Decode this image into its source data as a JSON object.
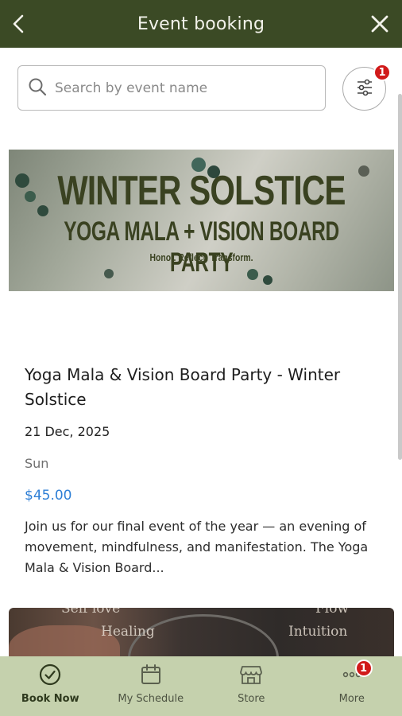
{
  "header": {
    "title": "Event booking"
  },
  "search": {
    "placeholder": "Search by event name",
    "value": ""
  },
  "filter": {
    "badge_count": "1"
  },
  "banner": {
    "line1": "WINTER SOLSTICE",
    "line2": "YOGA MALA + VISION BOARD PARTY",
    "line3": "Honor. Reflect. Transform."
  },
  "event": {
    "title": "Yoga Mala & Vision Board Party - Winter Solstice",
    "date": "21 Dec, 2025",
    "day": "Sun",
    "price": "$45.00",
    "description": "Join us for our final event of the year — an evening of movement, mindfulness, and manifestation. The Yoga Mala & Vision Board..."
  },
  "next_banner": {
    "words": [
      "Self love",
      "Flow",
      "Healing",
      "Intuition"
    ]
  },
  "nav": {
    "items": [
      {
        "label": "Book Now",
        "icon": "check-circle-icon"
      },
      {
        "label": "My Schedule",
        "icon": "calendar-icon"
      },
      {
        "label": "Store",
        "icon": "store-icon"
      },
      {
        "label": "More",
        "icon": "more-dots-icon",
        "badge": "1"
      }
    ]
  },
  "colors": {
    "header_bg": "#3b4a25",
    "nav_bg": "#c5d1ad",
    "price": "#2e7fd6",
    "badge": "#d11a1a"
  }
}
